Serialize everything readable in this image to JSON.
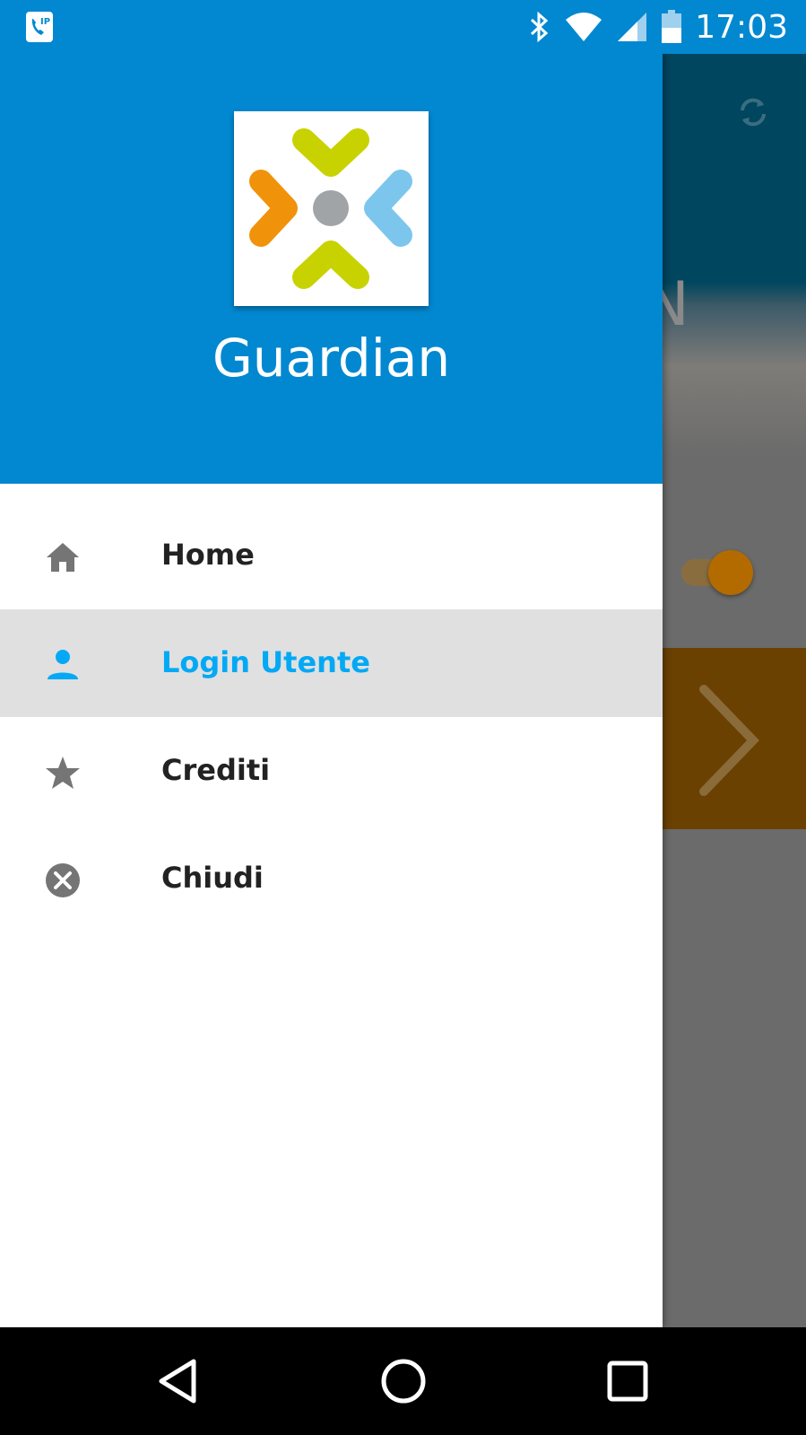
{
  "status_bar": {
    "time": "17:03",
    "icons": [
      "voip-call-icon",
      "bluetooth-icon",
      "wifi-icon",
      "signal-icon",
      "battery-icon"
    ]
  },
  "drawer": {
    "app_name": "Guardian",
    "logo_colors": {
      "top": "#c8d200",
      "bottom": "#c8d200",
      "left": "#f0930a",
      "right": "#7cc6ee",
      "center": "#a0a4a6"
    },
    "menu": [
      {
        "label": "Home",
        "icon": "home-icon",
        "active": false
      },
      {
        "label": "Login Utente",
        "icon": "person-icon",
        "active": true
      },
      {
        "label": "Crediti",
        "icon": "star-icon",
        "active": false
      },
      {
        "label": "Chiudi",
        "icon": "close-circle-icon",
        "active": false
      }
    ]
  },
  "background_app": {
    "partial_text": "N"
  },
  "colors": {
    "primary": "#0288d1",
    "accent": "#03a9f4",
    "active_item_bg": "#e0e0e0"
  }
}
